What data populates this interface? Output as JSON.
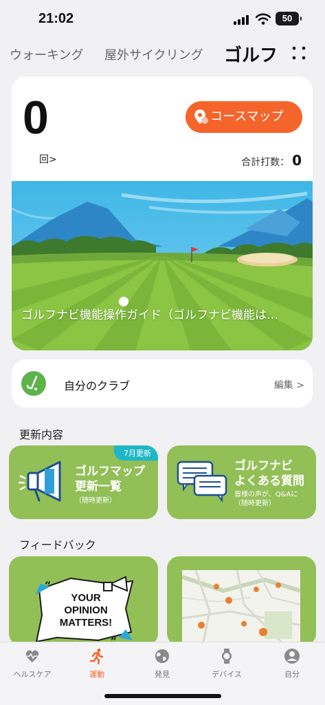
{
  "status_bar": {
    "time": "21:02",
    "battery": "50"
  },
  "tabs": [
    {
      "label": "ウォーキング"
    },
    {
      "label": "屋外サイクリング"
    },
    {
      "label": "ゴルフ"
    }
  ],
  "score": {
    "count": "0",
    "count_label": "回>",
    "course_map_button": "コースマップ",
    "total_label": "合計打数：",
    "total_value": "0"
  },
  "banner": {
    "caption": "ゴルフナビ機能操作ガイド（ゴルフナビ機能は…"
  },
  "clubs": {
    "label": "自分のクラブ",
    "edit_label": "編集 >"
  },
  "updates": {
    "section_title": "更新内容",
    "tiles": [
      {
        "badge": "7月更新",
        "title_line1": "ゴルフマップ",
        "title_line2": "更新一覧",
        "sub": "（随時更新）"
      },
      {
        "title_line1": "ゴルフナビ",
        "title_line2": "よくある質問",
        "sub_line1": "皆様の声が、Q&Aに",
        "sub_line2": "（随時更新）"
      }
    ]
  },
  "feedback": {
    "section_title": "フィードバック",
    "poster_text": [
      "YOUR",
      "OPINION",
      "MATTERS!"
    ]
  },
  "bottom_nav": [
    {
      "label": "ヘルスケア",
      "icon": "heart-icon"
    },
    {
      "label": "運動",
      "icon": "running-icon"
    },
    {
      "label": "発見",
      "icon": "globe-icon"
    },
    {
      "label": "デバイス",
      "icon": "watch-icon"
    },
    {
      "label": "自分",
      "icon": "person-icon"
    }
  ],
  "colors": {
    "accent": "#f5642a",
    "tile_green": "#93bf57",
    "badge_teal": "#20b6c9"
  }
}
